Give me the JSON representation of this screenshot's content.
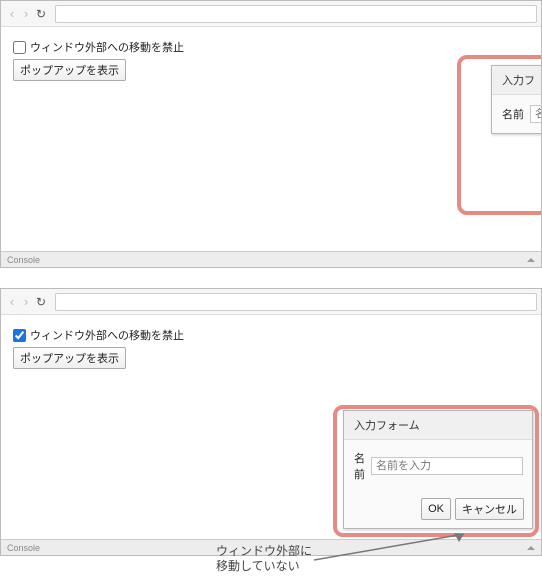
{
  "console_label": "Console",
  "example1": {
    "prohibit_label": "ウィンドウ外部への移動を禁止",
    "prohibit_checked": false,
    "show_popup_btn": "ポップアップを表示",
    "popup": {
      "title": "入力フ",
      "name_label": "名前",
      "name_placeholder": "名前を入"
    }
  },
  "example2": {
    "prohibit_label": "ウィンドウ外部への移動を禁止",
    "prohibit_checked": true,
    "show_popup_btn": "ポップアップを表示",
    "popup": {
      "title": "入力フォーム",
      "name_label": "名前",
      "name_placeholder": "名前を入力",
      "ok_btn": "OK",
      "cancel_btn": "キャンセル"
    }
  },
  "annotation": "ウィンドウ外部に\n移動していない"
}
